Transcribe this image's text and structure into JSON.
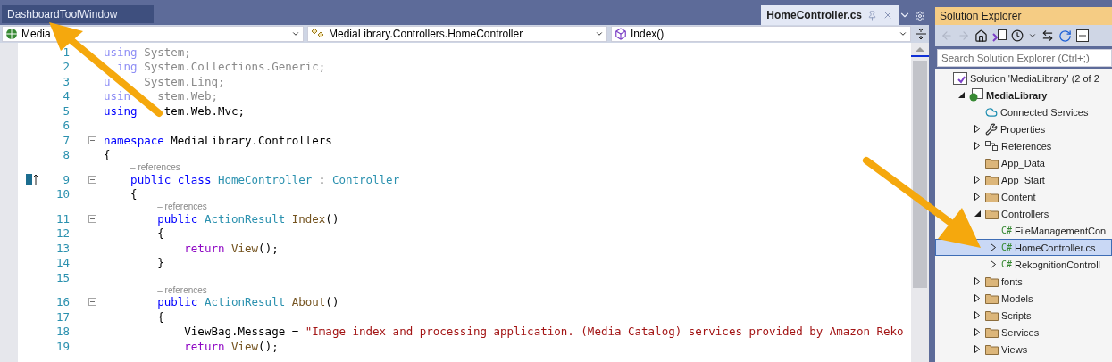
{
  "document_tabs": [
    {
      "label": "DashboardToolWindow",
      "selected": false
    },
    {
      "label": "HomeController.cs",
      "selected": true
    }
  ],
  "navigation_bar": {
    "project": "Media",
    "type": "MediaLibrary.Controllers.HomeController",
    "member": "Index()"
  },
  "code_lines": [
    {
      "number": "1",
      "tokens": [
        {
          "kind": "dim-kw",
          "text": "using"
        },
        {
          "kind": "dim",
          "text": " System;"
        }
      ]
    },
    {
      "number": "2",
      "tokens": [
        {
          "kind": "dim-kw",
          "text": "  ing"
        },
        {
          "kind": "dim",
          "text": " System.Collections.Generic;"
        }
      ]
    },
    {
      "number": "3",
      "tokens": [
        {
          "kind": "dim-kw",
          "text": "u"
        },
        {
          "kind": "dim",
          "text": "     System.Linq;"
        }
      ]
    },
    {
      "number": "4",
      "tokens": [
        {
          "kind": "dim-kw",
          "text": "usin"
        },
        {
          "kind": "dim",
          "text": "    stem.Web;"
        }
      ]
    },
    {
      "number": "5",
      "tokens": [
        {
          "kind": "kw",
          "text": "using"
        },
        {
          "kind": "plain",
          "text": "    tem.Web.Mvc;"
        }
      ]
    },
    {
      "number": "6"
    },
    {
      "number": "7",
      "fold": true,
      "tokens": [
        {
          "kind": "kw",
          "text": "namespace"
        },
        {
          "kind": "plain",
          "text": " MediaLibrary.Controllers"
        }
      ]
    },
    {
      "number": "8",
      "tokens": [
        {
          "kind": "plain",
          "text": "{"
        }
      ]
    },
    {
      "number": "9",
      "fold": true,
      "gutter_icon": true,
      "codelens": "– references",
      "tokens": [
        {
          "kind": "kw",
          "text": "    public class"
        },
        {
          "kind": "type",
          "text": " HomeController"
        },
        {
          "kind": "plain",
          "text": " :"
        },
        {
          "kind": "type",
          "text": " Controller"
        }
      ]
    },
    {
      "number": "10",
      "tokens": [
        {
          "kind": "plain",
          "text": "    {"
        }
      ]
    },
    {
      "number": "11",
      "fold": true,
      "codelens": "– references",
      "tokens": [
        {
          "kind": "kw",
          "text": "        public"
        },
        {
          "kind": "type",
          "text": " ActionResult"
        },
        {
          "kind": "method",
          "text": " Index"
        },
        {
          "kind": "plain",
          "text": "()"
        }
      ]
    },
    {
      "number": "12",
      "tokens": [
        {
          "kind": "plain",
          "text": "        {"
        }
      ]
    },
    {
      "number": "13",
      "tokens": [
        {
          "kind": "control",
          "text": "            return"
        },
        {
          "kind": "method",
          "text": " View"
        },
        {
          "kind": "plain",
          "text": "();"
        }
      ]
    },
    {
      "number": "14",
      "tokens": [
        {
          "kind": "plain",
          "text": "        }"
        }
      ]
    },
    {
      "number": "15"
    },
    {
      "number": "16",
      "fold": true,
      "codelens": "– references",
      "tokens": [
        {
          "kind": "kw",
          "text": "        public"
        },
        {
          "kind": "type",
          "text": " ActionResult"
        },
        {
          "kind": "method",
          "text": " About"
        },
        {
          "kind": "plain",
          "text": "()"
        }
      ]
    },
    {
      "number": "17",
      "tokens": [
        {
          "kind": "plain",
          "text": "        {"
        }
      ]
    },
    {
      "number": "18",
      "tokens": [
        {
          "kind": "plain",
          "text": "            ViewBag.Message ="
        },
        {
          "kind": "str",
          "text": " \"Image index and processing application. (Media Catalog) services provided by Amazon Reko"
        }
      ]
    },
    {
      "number": "19",
      "tokens": [
        {
          "kind": "control",
          "text": "            return"
        },
        {
          "kind": "method",
          "text": " View"
        },
        {
          "kind": "plain",
          "text": "();"
        }
      ]
    }
  ],
  "solution_explorer": {
    "title": "Solution Explorer",
    "search": {
      "placeholder": "Search Solution Explorer (Ctrl+;)"
    },
    "tree": [
      {
        "label": "Solution 'MediaLibrary' (2 of 2",
        "kind": "solution",
        "selected": false,
        "children": [
          {
            "label": "MediaLibrary",
            "kind": "web-project",
            "bold": true,
            "expanded": true,
            "selected": false,
            "children": [
              {
                "label": "Connected Services",
                "kind": "cloud",
                "selected": false
              },
              {
                "label": "Properties",
                "kind": "wrench",
                "expanded": false,
                "selected": false
              },
              {
                "label": "References",
                "kind": "references",
                "expanded": false,
                "selected": false
              },
              {
                "label": "App_Data",
                "kind": "folder",
                "selected": false
              },
              {
                "label": "App_Start",
                "kind": "folder",
                "expanded": false,
                "selected": false
              },
              {
                "label": "Content",
                "kind": "folder",
                "expanded": false,
                "selected": false
              },
              {
                "label": "Controllers",
                "kind": "folder",
                "expanded": true,
                "selected": false,
                "children": [
                  {
                    "label": "FileManagementCon",
                    "kind": "file",
                    "file_type": "C#",
                    "selected": false
                  },
                  {
                    "label": "HomeController.cs",
                    "kind": "file",
                    "file_type": "C#",
                    "expanded": false,
                    "selected": true
                  },
                  {
                    "label": "RekognitionControll",
                    "kind": "file",
                    "file_type": "C#",
                    "expanded": false,
                    "selected": false
                  }
                ]
              },
              {
                "label": "fonts",
                "kind": "folder",
                "expanded": false,
                "selected": false
              },
              {
                "label": "Models",
                "kind": "folder",
                "expanded": false,
                "selected": false
              },
              {
                "label": "Scripts",
                "kind": "folder",
                "expanded": false,
                "selected": false
              },
              {
                "label": "Services",
                "kind": "folder",
                "expanded": false,
                "selected": false
              },
              {
                "label": "Views",
                "kind": "folder",
                "expanded": false,
                "selected": false
              }
            ]
          }
        ]
      }
    ]
  }
}
